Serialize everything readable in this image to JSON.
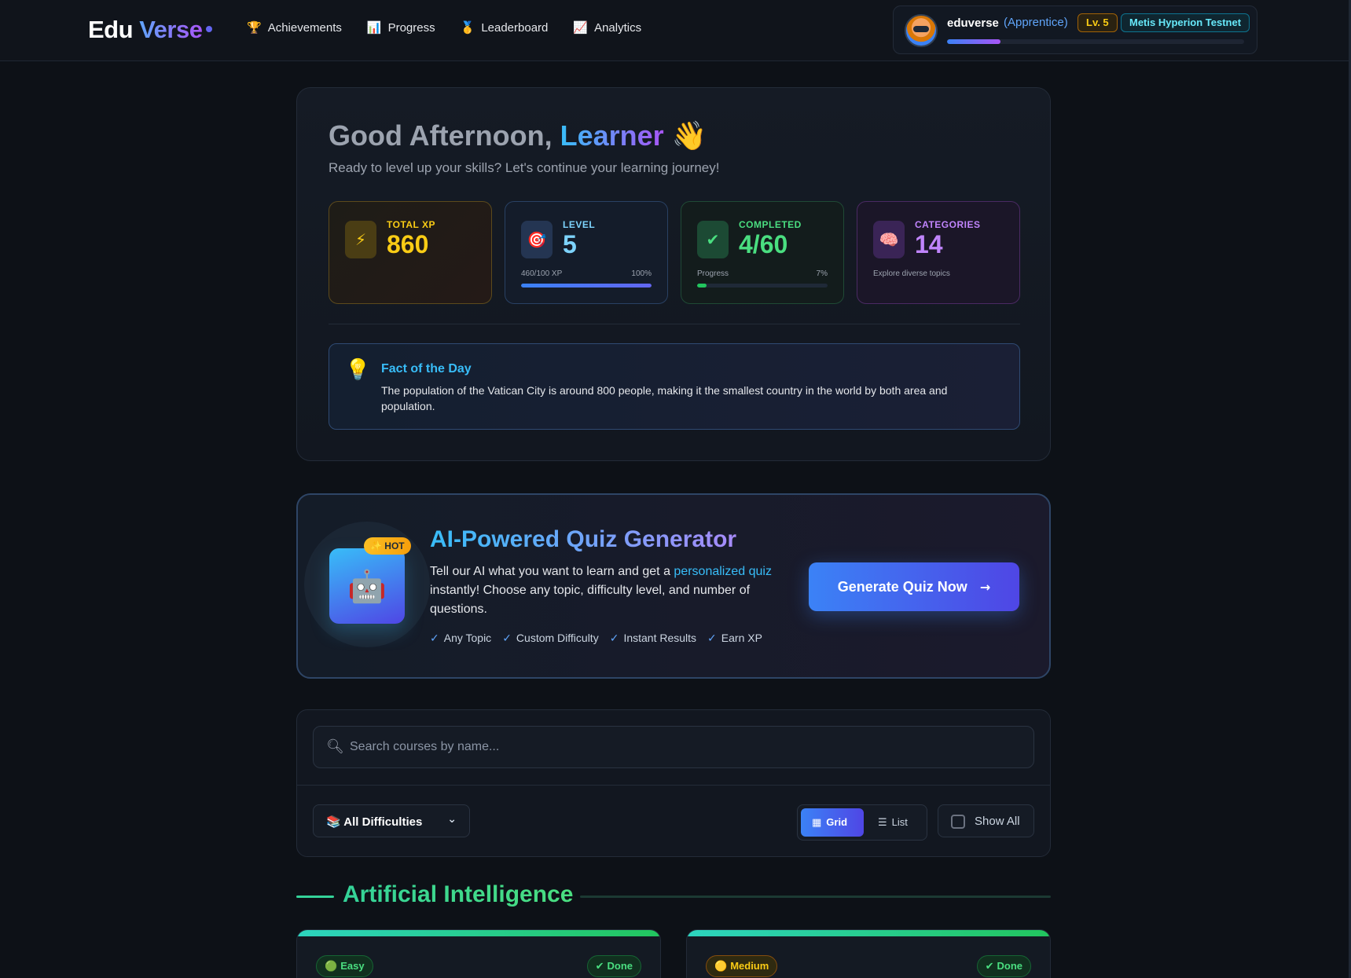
{
  "navbar": {
    "logo_part1": "Edu",
    "logo_part2": "Verse",
    "links": [
      {
        "icon": "trophy-icon",
        "glyph": "🏆",
        "label": "Achievements"
      },
      {
        "icon": "bar-chart-icon",
        "glyph": "📊",
        "label": "Progress"
      },
      {
        "icon": "medal-icon",
        "glyph": "🥇",
        "label": "Leaderboard"
      },
      {
        "icon": "chart-up-icon",
        "glyph": "📈",
        "label": "Analytics"
      }
    ],
    "user": {
      "name": "eduverse",
      "rank": "(Apprentice)",
      "level": "Lv. 5",
      "network": "Metis Hyperion Testnet",
      "xp_progress": 0.18
    }
  },
  "welcome": {
    "greeting": "Good Afternoon,",
    "name": "Learner",
    "wave": "👋",
    "subtitle": "Ready to level up your skills? Let's continue your learning journey!",
    "stats": {
      "xp": {
        "label": "TOTAL XP",
        "value": "860",
        "icon": "⚡"
      },
      "level": {
        "label": "LEVEL",
        "value": "5",
        "icon": "🎯",
        "foot_left": "460/100 XP",
        "foot_right": "100%",
        "progress": 1.0
      },
      "completed": {
        "label": "COMPLETED",
        "value": "4/60",
        "icon": "✔",
        "foot_left": "Progress",
        "foot_right": "7%",
        "progress": 0.07
      },
      "categories": {
        "label": "CATEGORIES",
        "value": "14",
        "icon": "🧠",
        "foot_left": "Explore diverse topics"
      }
    },
    "fact": {
      "title": "Fact of the Day",
      "text": "The population of the Vatican City is around 800 people, making it the smallest country in the world by both area and population."
    }
  },
  "ai_card": {
    "badge": "✨ HOT",
    "robot": "🤖",
    "title": "AI-Powered Quiz Generator",
    "desc_before": "Tell our AI what you want to learn and get a ",
    "desc_highlight": "personalized quiz",
    "desc_after": " instantly! Choose any topic, difficulty level, and number of questions.",
    "features": [
      "Any Topic",
      "Custom Difficulty",
      "Instant Results",
      "Earn XP"
    ],
    "button_label": "Generate Quiz Now",
    "button_arrow": "→"
  },
  "filters": {
    "search_placeholder": "Search courses by name...",
    "difficulty_selected": "📚 All Difficulties",
    "view_grid": "Grid",
    "view_list": "List",
    "show_all": "Show All"
  },
  "section": {
    "title": "Artificial Intelligence",
    "cards": [
      {
        "difficulty": "Easy",
        "difficulty_glyph": "🟢",
        "status": "Done"
      },
      {
        "difficulty": "Medium",
        "difficulty_glyph": "🟡",
        "status": "Done"
      }
    ]
  },
  "colors": {
    "background": "#0d1117",
    "accent_blue": "#3b82f6",
    "accent_purple": "#a855f7",
    "xp_gold": "#facc15",
    "success_green": "#4ade80"
  }
}
